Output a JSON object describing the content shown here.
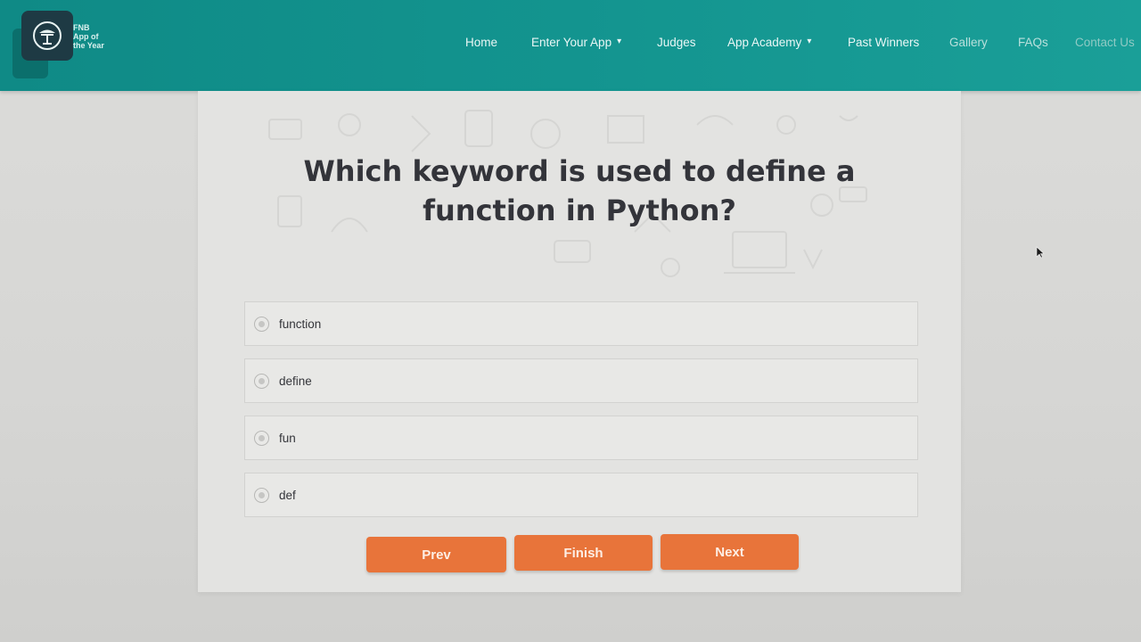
{
  "brand": {
    "logo_text_line1": "FNB",
    "logo_text_line2": "App of",
    "logo_text_line3": "the Year",
    "icon": "tree-icon"
  },
  "nav": {
    "items": [
      {
        "label": "Home",
        "dropdown": false
      },
      {
        "label": "Enter Your App",
        "dropdown": true
      },
      {
        "label": "Judges",
        "dropdown": false
      },
      {
        "label": "App Academy",
        "dropdown": true
      },
      {
        "label": "Past Winners",
        "dropdown": false
      },
      {
        "label": "Gallery",
        "dropdown": false
      },
      {
        "label": "FAQs",
        "dropdown": false
      },
      {
        "label": "Contact Us",
        "dropdown": false
      }
    ]
  },
  "quiz": {
    "question_line1": "Which keyword is used to define a",
    "question_line2": "function in Python?",
    "options": [
      {
        "label": "function",
        "selected": false
      },
      {
        "label": "define",
        "selected": false
      },
      {
        "label": "fun",
        "selected": false
      },
      {
        "label": "def",
        "selected": false
      }
    ],
    "buttons": {
      "prev": "Prev",
      "finish": "Finish",
      "next": "Next"
    }
  },
  "colors": {
    "header": "#13948f",
    "button": "#e8743a",
    "question_text": "#33343a"
  }
}
